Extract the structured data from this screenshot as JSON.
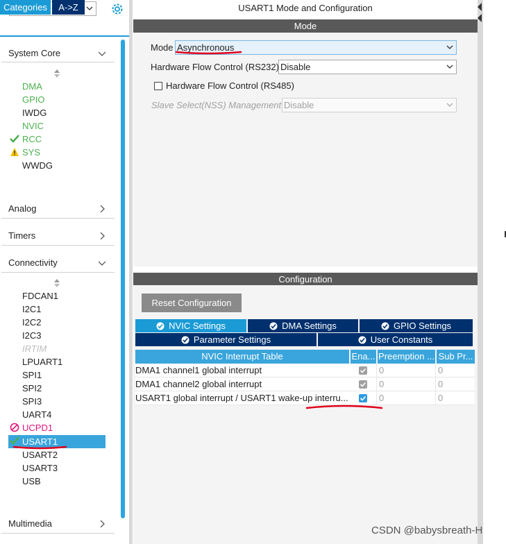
{
  "sidebar": {
    "tabs": {
      "categories": "Categories",
      "az": "A->Z"
    },
    "sections": {
      "system_core": "System Core",
      "analog": "Analog",
      "timers": "Timers",
      "connectivity": "Connectivity",
      "multimedia": "Multimedia"
    },
    "system_core_items": [
      "DMA",
      "GPIO",
      "IWDG",
      "NVIC",
      "RCC",
      "SYS",
      "WWDG"
    ],
    "connectivity_items": [
      "FDCAN1",
      "I2C1",
      "I2C2",
      "I2C3",
      "IRTIM",
      "LPUART1",
      "SPI1",
      "SPI2",
      "SPI3",
      "UART4",
      "UCPD1",
      "USART1",
      "USART2",
      "USART3",
      "USB"
    ],
    "selected_item": "USART1"
  },
  "main": {
    "title": "USART1 Mode and Configuration",
    "mode_bar": "Mode",
    "mode_label": "Mode",
    "mode_value": "Asynchronous",
    "hw_flow_rs232_label": "Hardware Flow Control (RS232)",
    "hw_flow_rs232_value": "Disable",
    "hw_flow_rs485_label": "Hardware Flow Control (RS485)",
    "slave_select_label": "Slave Select(NSS) Management",
    "slave_select_value": "Disable",
    "config_bar": "Configuration",
    "reset_button": "Reset Configuration",
    "tabs": {
      "nvic": "NVIC Settings",
      "dma": "DMA Settings",
      "gpio": "GPIO Settings",
      "params": "Parameter Settings",
      "user_consts": "User Constants"
    },
    "table": {
      "headers": [
        "NVIC Interrupt Table",
        "Ena...",
        "Preemption ...",
        "Sub Pr..."
      ],
      "rows": [
        {
          "name": "DMA1 channel1 global interrupt",
          "enabled": true,
          "preemption": "0",
          "sub": "0"
        },
        {
          "name": "DMA1 channel2 global interrupt",
          "enabled": true,
          "preemption": "0",
          "sub": "0"
        },
        {
          "name": "USART1 global interrupt / USART1 wake-up interru...",
          "enabled": true,
          "preemption": "0",
          "sub": "0"
        }
      ]
    }
  },
  "watermark": "CSDN @babysbreath-H",
  "colors": {
    "accent": "#1b9bd6",
    "dark_tab": "#01306e",
    "bar": "#595959",
    "green": "#4caf50",
    "warn": "#f2c200",
    "error": "#e0147b",
    "annotation": "#e0001a"
  }
}
